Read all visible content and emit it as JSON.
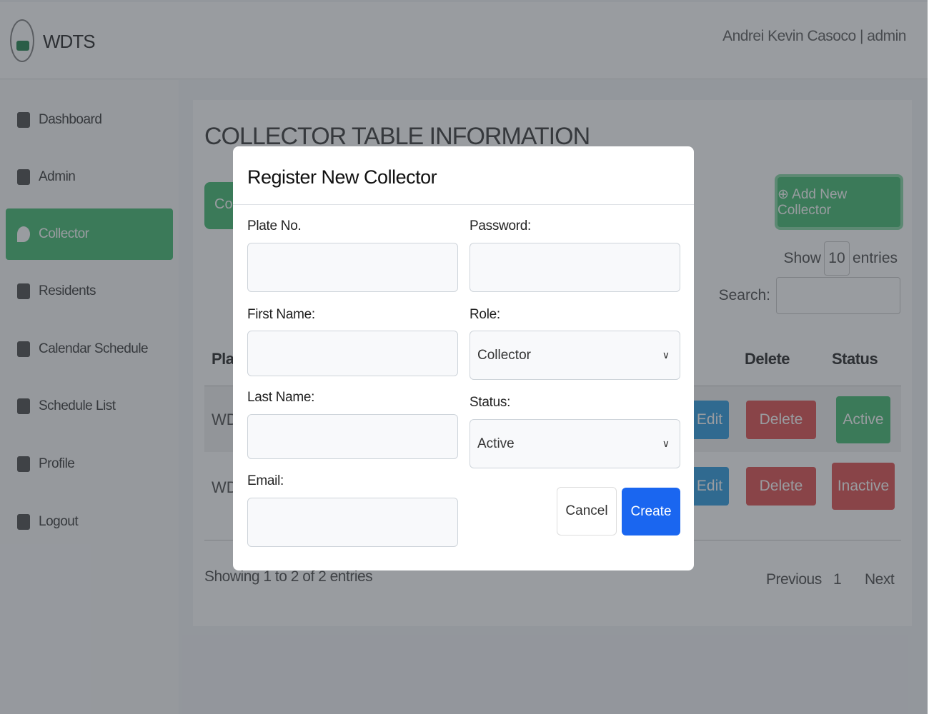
{
  "header": {
    "brand": "WDTS",
    "user": "Andrei Kevin Casoco | admin"
  },
  "sidebar": {
    "items": [
      {
        "label": "Dashboard",
        "icon": "dashboard-icon"
      },
      {
        "label": "Admin",
        "icon": "user-icon"
      },
      {
        "label": "Collector",
        "icon": "map-pin-icon",
        "active": true
      },
      {
        "label": "Residents",
        "icon": "user-icon"
      },
      {
        "label": "Calendar Schedule",
        "icon": "calendar-icon"
      },
      {
        "label": "Schedule List",
        "icon": "calendar-icon"
      },
      {
        "label": "Profile",
        "icon": "profile-icon"
      },
      {
        "label": "Logout",
        "icon": "logout-icon"
      }
    ]
  },
  "main": {
    "title": "COLLECTOR TABLE INFORMATION",
    "copy_label": "Cop",
    "add_label": "⊕ Add New Collector",
    "show_label": "Show",
    "show_value": "10",
    "entries_label": "entries",
    "search_label": "Search:",
    "headers": [
      "Plate",
      "Delete",
      "Status"
    ],
    "rows": [
      {
        "plate": "WDT",
        "edit": "Edit",
        "delete": "Delete",
        "status": "Active"
      },
      {
        "plate": "WDT",
        "edit": "Edit",
        "delete": "Delete",
        "status": "Inactive"
      }
    ],
    "showing": "Showing 1 to 2 of 2 entries",
    "prev": "Previous",
    "page": "1",
    "next": "Next"
  },
  "modal": {
    "title": "Register New Collector",
    "plate_label": "Plate No.",
    "password_label": "Password:",
    "first_label": "First Name:",
    "role_label": "Role:",
    "role_value": "Collector",
    "last_label": "Last Name:",
    "status_label": "Status:",
    "status_value": "Active",
    "email_label": "Email:",
    "cancel": "Cancel",
    "create": "Create"
  }
}
